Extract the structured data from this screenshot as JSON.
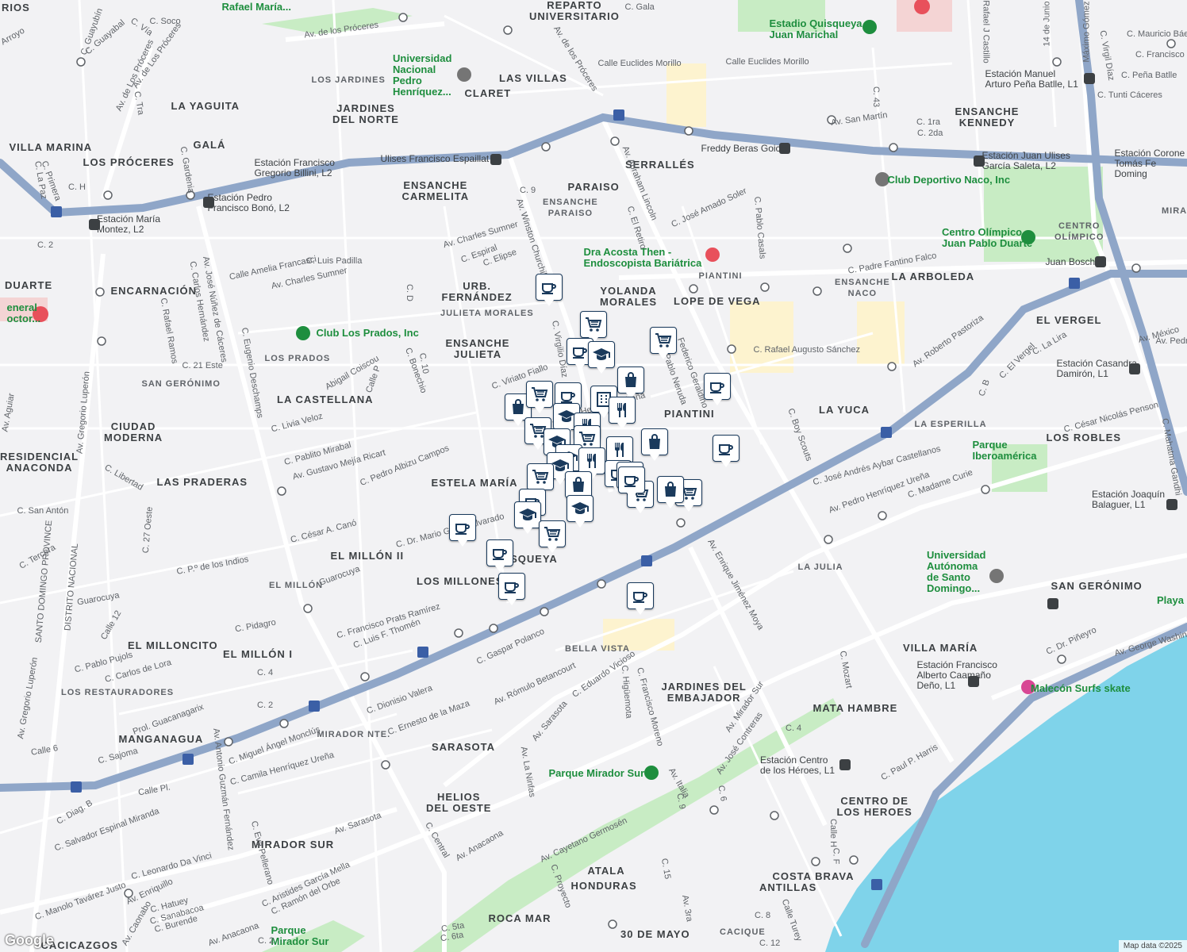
{
  "map": {
    "attribution": "Map data ©2025",
    "logo_text": "Google",
    "colors": {
      "water": "#7fd3ea",
      "park": "#c8ecc4",
      "highway": "#8fa6c8",
      "road": "#ffffff",
      "land": "#f2f2f4",
      "marker_fill": "#1a3a5c",
      "commercial": "#fdf3cf",
      "hospital": "#f4d4d4"
    }
  },
  "neighborhoods": [
    {
      "text": "REPARTO\nUNIVERSITARIO"
    },
    {
      "text": "LAS VILLAS"
    },
    {
      "text": "CLARET"
    },
    {
      "text": "LA YAGUITA"
    },
    {
      "text": "JARDINES\nDEL NORTE"
    },
    {
      "text": "VILLA MARINA"
    },
    {
      "text": "GALÁ"
    },
    {
      "text": "LOS PRÓCERES"
    },
    {
      "text": "ENSANCHE\nCARMELITA"
    },
    {
      "text": "PARAISO"
    },
    {
      "text": "SERRALLÉS"
    },
    {
      "text": "ENSANCHE\nKENNEDY"
    },
    {
      "text": "DUARTE"
    },
    {
      "text": "ENCARNACIÓN"
    },
    {
      "text": "URB.\nFERNÁNDEZ"
    },
    {
      "text": "YOLANDA\nMORALES"
    },
    {
      "text": "LOPE DE VEGA"
    },
    {
      "text": "LA ARBOLEDA"
    },
    {
      "text": "ENSANCHE\nJULIETA"
    },
    {
      "text": "EL VERGEL"
    },
    {
      "text": "LA CASTELLANA"
    },
    {
      "text": "PIANTINI"
    },
    {
      "text": "LA YUCA"
    },
    {
      "text": "CIUDAD\nMODERNA"
    },
    {
      "text": "RESIDENCIAL\nANACONDA"
    },
    {
      "text": "LAS PRADERAS"
    },
    {
      "text": "ESTELA MARÍA"
    },
    {
      "text": "LOS ROBLES"
    },
    {
      "text": "EL MILLÓN II"
    },
    {
      "text": "LOS MILLONES"
    },
    {
      "text": "QUISQUEYA"
    },
    {
      "text": "SAN GERÓNIMO"
    },
    {
      "text": "EL MILLONCITO"
    },
    {
      "text": "EL MILLÓN I"
    },
    {
      "text": "VILLA MARÍA"
    },
    {
      "text": "JARDINES DEL\nEMBAJADOR"
    },
    {
      "text": "MATA HAMBRE"
    },
    {
      "text": "MANGANAGUA"
    },
    {
      "text": "SARASOTA"
    },
    {
      "text": "HELIOS\nDEL OESTE"
    },
    {
      "text": "CENTRO DE\nLOS HEROES"
    },
    {
      "text": "MIRADOR SUR"
    },
    {
      "text": "ATALA"
    },
    {
      "text": "HONDURAS"
    },
    {
      "text": "COSTA BRAVA"
    },
    {
      "text": "ANTILLAS"
    },
    {
      "text": "ROCA MAR"
    },
    {
      "text": "30 DE MAYO"
    },
    {
      "text": "CACICAZGOS"
    },
    {
      "text": "RIOS"
    }
  ],
  "small_areas": [
    {
      "text": "LOS JARDINES"
    },
    {
      "text": "ENSANCHE\nPARAISO"
    },
    {
      "text": "JULIETA MORALES"
    },
    {
      "text": "LOS PRADOS"
    },
    {
      "text": "SAN GERÓNIMO"
    },
    {
      "text": "PIANTINI"
    },
    {
      "text": "ENSANCHE\nNACO"
    },
    {
      "text": "CENTRO\nOLÍMPICO"
    },
    {
      "text": "LA ESPERILLA"
    },
    {
      "text": "LA JULIA"
    },
    {
      "text": "BELLA VISTA"
    },
    {
      "text": "EL MILLÓN"
    },
    {
      "text": "LOS RESTAURADORES"
    },
    {
      "text": "MIRADOR NTE."
    },
    {
      "text": "CACIQUE"
    },
    {
      "text": "MIRA"
    }
  ],
  "pois": [
    {
      "text": "Estadio Quisqueya\nJuan Marichal"
    },
    {
      "text": "Universidad\nNacional\nPedro\nHenríquez..."
    },
    {
      "text": "Club Deportivo Naco, Inc"
    },
    {
      "text": "Dra Acosta Then -\nEndoscopista Bariátrica"
    },
    {
      "text": "Centro Olímpico\nJuan Pablo Duarte"
    },
    {
      "text": "Club Los Prados, Inc"
    },
    {
      "text": "Parque\nIberoamérica"
    },
    {
      "text": "Universidad\nAutónoma\nde Santo\nDomingo..."
    },
    {
      "text": "Malecón Surfs skate"
    },
    {
      "text": "Parque Mirador Sur"
    },
    {
      "text": "Parque\nMirador Sur"
    },
    {
      "text": "Rafael María..."
    },
    {
      "text": "eneral\noctor..."
    },
    {
      "text": "Playa"
    }
  ],
  "stations": [
    {
      "text": "Estación Manuel\nArturo Peña Batlle, L1"
    },
    {
      "text": "Freddy Beras Goico"
    },
    {
      "text": "Estación Juan Ulises\nGarcía Saleta, L2"
    },
    {
      "text": "Estación Corone\nTomás Fe\nDoming"
    },
    {
      "text": "Ulises Francisco Espaillat"
    },
    {
      "text": "Estación Francisco\nGregorio Billini, L2"
    },
    {
      "text": "Estación Pedro\nFrancisco Bonó, L2"
    },
    {
      "text": "Estación María\nMontez, L2"
    },
    {
      "text": "Juan Bosch"
    },
    {
      "text": "Estación Casandra\nDamirón, L1"
    },
    {
      "text": "Estación Joaquín\nBalaguer, L1"
    },
    {
      "text": "Estación Francisco\nAlberto Caamaño\nDeño, L1"
    },
    {
      "text": "Estación Centro\nde los Héroes, L1"
    }
  ],
  "streets": [
    {
      "text": "Av. de los Próceres"
    },
    {
      "text": "Av. de Los Próceres"
    },
    {
      "text": "Av. de los Próceres"
    },
    {
      "text": "Calle Euclides Morillo"
    },
    {
      "text": "Calle Euclides Morillo"
    },
    {
      "text": "Av. San Martín"
    },
    {
      "text": "Av. Abraham Lincoln"
    },
    {
      "text": "Av. Winston Churchill"
    },
    {
      "text": "C. José Amado Soler"
    },
    {
      "text": "C. Padre Fantino Falco"
    },
    {
      "text": "C. Rafael Augusto Sánchez"
    },
    {
      "text": "Av. Roberto Pastoriza"
    },
    {
      "text": "Av. Charles Sumner"
    },
    {
      "text": "Av. Charles Sumner"
    },
    {
      "text": "Calle Amelia Francasci"
    },
    {
      "text": "C. Luis Padilla"
    },
    {
      "text": "Av. José Núñez de Cáceres"
    },
    {
      "text": "C. Eugenio Deschamps"
    },
    {
      "text": "Av. Gregorio Luperón"
    },
    {
      "text": "C. 27 Oeste"
    },
    {
      "text": "C. Livia Veloz"
    },
    {
      "text": "C. Pablito Mirabal"
    },
    {
      "text": "Av. Gustavo Mejía Ricart"
    },
    {
      "text": "C. Pedro Albizu Campos"
    },
    {
      "text": "C. César A. Canó"
    },
    {
      "text": "C. Dr. Mario García Alvarado"
    },
    {
      "text": "C. Francisco Prats Ramírez"
    },
    {
      "text": "C. Luis F. Thomén"
    },
    {
      "text": "C. Gaspar Polanco"
    },
    {
      "text": "Av. Rómulo Betancourt"
    },
    {
      "text": "Av. Enrique Jiménez Moya"
    },
    {
      "text": "C. Eduardo Vicioso"
    },
    {
      "text": "C. Francisco Moreno"
    },
    {
      "text": "C. Higüemota"
    },
    {
      "text": "Av. Mirador Sur"
    },
    {
      "text": "Av. José Contreras"
    },
    {
      "text": "Av. Italia"
    },
    {
      "text": "Av. Sarasota"
    },
    {
      "text": "Av. La Ninfas"
    },
    {
      "text": "Av. Anacaona"
    },
    {
      "text": "Av. Cayetano Germosén"
    },
    {
      "text": "C. Proyecto"
    },
    {
      "text": "Av. George Washington"
    },
    {
      "text": "C. Dr. Piñeyro"
    },
    {
      "text": "C. Paul P. Harris"
    },
    {
      "text": "Av. Pedro Henríquez Ureña"
    },
    {
      "text": "C. Madame Curie"
    },
    {
      "text": "C. José Andrés Aybar Castellanos"
    },
    {
      "text": "C. César Nicolás Penson"
    },
    {
      "text": "Av. México"
    },
    {
      "text": "C. Boy Scouts"
    },
    {
      "text": "C. Pablo Casals"
    },
    {
      "text": "C. El Retiro"
    },
    {
      "text": "C. Virgilio Díaz"
    },
    {
      "text": "C. Viriato Fiallo"
    },
    {
      "text": "C. Espiral"
    },
    {
      "text": "C. Elipse"
    },
    {
      "text": "C. 9"
    },
    {
      "text": "C. Bonechio"
    },
    {
      "text": "Abigail Coiscou"
    },
    {
      "text": "Calle P"
    },
    {
      "text": "C. 10"
    },
    {
      "text": "C. D"
    },
    {
      "text": "C. 21 Este"
    },
    {
      "text": "C. Rafael Ramos"
    },
    {
      "text": "C. Carlos Hernández"
    },
    {
      "text": "C. Gardenia"
    },
    {
      "text": "C. Primera"
    },
    {
      "text": "C. La Paz"
    },
    {
      "text": "C. H"
    },
    {
      "text": "C. 2"
    },
    {
      "text": "Av. Antonio Guzmán Fernández"
    },
    {
      "text": "C. Eva Pellerano"
    },
    {
      "text": "Av. Enriquillo"
    },
    {
      "text": "C. Hatuey"
    },
    {
      "text": "C. Sanabacoa"
    },
    {
      "text": "C. Burende"
    },
    {
      "text": "C. Manolo Tavárez Justo"
    },
    {
      "text": "Av. Caonabo"
    },
    {
      "text": "C. Leonardo Da Vinci"
    },
    {
      "text": "C. Salvador Espinal Miranda"
    },
    {
      "text": "C. Diag. B"
    },
    {
      "text": "Calle Pl."
    },
    {
      "text": "C. Camila Henríquez Ureña"
    },
    {
      "text": "C. Miguel Ángel Monclús"
    },
    {
      "text": "C. Sajoma"
    },
    {
      "text": "Prol. Guacanagarix"
    },
    {
      "text": "C. Dionisio Valera"
    },
    {
      "text": "C. Ernesto de la Maza"
    },
    {
      "text": "C. Pablo Pujols"
    },
    {
      "text": "C. Carlos de Lora"
    },
    {
      "text": "C. Pidagro"
    },
    {
      "text": "Guarocuya"
    },
    {
      "text": "Guarocuya"
    },
    {
      "text": "C. P.º de los Indios"
    },
    {
      "text": "C. Tercera"
    },
    {
      "text": "C. San Antón"
    },
    {
      "text": "C. Libertad"
    },
    {
      "text": "SANTO DOMINGO PROVINCE"
    },
    {
      "text": "DISTRITO NACIONAL"
    },
    {
      "text": "Av. Gregorio Luperón"
    },
    {
      "text": "Av. Aguiar"
    },
    {
      "text": "Calle 6"
    },
    {
      "text": "Calle 12"
    },
    {
      "text": "C. 4"
    },
    {
      "text": "C. 2"
    },
    {
      "text": "C. Aristides García Mella"
    },
    {
      "text": "C. Ramón del Orbe"
    },
    {
      "text": "Av. Sarasota"
    },
    {
      "text": "C. Central"
    },
    {
      "text": "C. 43"
    },
    {
      "text": "C. 1ra"
    },
    {
      "text": "C. 2da"
    },
    {
      "text": "C. Tunti Cáceres"
    },
    {
      "text": "C. Peña Batlle"
    },
    {
      "text": "C. Francisco"
    },
    {
      "text": "C. Mauricio Báez"
    },
    {
      "text": "C. Virgil Díaz"
    },
    {
      "text": "Máximo Gómez"
    },
    {
      "text": "Rafael J Castillo"
    },
    {
      "text": "14 de Junio"
    },
    {
      "text": "C. Gala"
    },
    {
      "text": "C. Soco"
    },
    {
      "text": "C. Vía"
    },
    {
      "text": "C. Guayabal"
    },
    {
      "text": "C. Guayubín"
    },
    {
      "text": "Arroyo"
    },
    {
      "text": "Av. de Los Próceres"
    },
    {
      "text": "C. Tra"
    },
    {
      "text": "C. 8"
    },
    {
      "text": "C. 12"
    },
    {
      "text": "Calle Turey"
    },
    {
      "text": "C. F"
    },
    {
      "text": "Calle H"
    },
    {
      "text": "C. Mozart"
    },
    {
      "text": "C. 4"
    },
    {
      "text": "C. 6"
    },
    {
      "text": "C. 9"
    },
    {
      "text": "C. 15"
    },
    {
      "text": "Av. 3ra"
    },
    {
      "text": "C. 5ta"
    },
    {
      "text": "C. 6ta"
    },
    {
      "text": "C. 2"
    },
    {
      "text": "Av. Anacaona"
    },
    {
      "text": "C. El Vergel"
    },
    {
      "text": "C. La Lira"
    },
    {
      "text": "C. B"
    },
    {
      "text": "Av. Pedro"
    },
    {
      "text": "C. Mahatma Gandhi"
    },
    {
      "text": "C. Pedro Henríquez Ureña"
    },
    {
      "text": "Pablo Neruda"
    },
    {
      "text": "Federico Geraldino"
    }
  ],
  "markers": [
    {
      "icon": "coffee"
    },
    {
      "icon": "cart"
    },
    {
      "icon": "coffee"
    },
    {
      "icon": "graduation"
    },
    {
      "icon": "cart"
    },
    {
      "icon": "coffee"
    },
    {
      "icon": "bag"
    },
    {
      "icon": "bag"
    },
    {
      "icon": "cart"
    },
    {
      "icon": "coffee"
    },
    {
      "icon": "building"
    },
    {
      "icon": "graduation"
    },
    {
      "icon": "cart"
    },
    {
      "icon": "restaurant"
    },
    {
      "icon": "restaurant"
    },
    {
      "icon": "graduation"
    },
    {
      "icon": "cart"
    },
    {
      "icon": "graduation"
    },
    {
      "icon": "restaurant"
    },
    {
      "icon": "bag"
    },
    {
      "icon": "graduation"
    },
    {
      "icon": "restaurant"
    },
    {
      "icon": "coffee"
    },
    {
      "icon": "cart"
    },
    {
      "icon": "bag"
    },
    {
      "icon": "coffee"
    },
    {
      "icon": "cart"
    },
    {
      "icon": "coffee"
    },
    {
      "icon": "graduation"
    },
    {
      "icon": "coffee"
    },
    {
      "icon": "graduation"
    },
    {
      "icon": "cart"
    },
    {
      "icon": "coffee"
    },
    {
      "icon": "coffee"
    },
    {
      "icon": "coffee"
    },
    {
      "icon": "coffee"
    },
    {
      "icon": "cart"
    },
    {
      "icon": "bag"
    },
    {
      "icon": "coffee"
    }
  ]
}
